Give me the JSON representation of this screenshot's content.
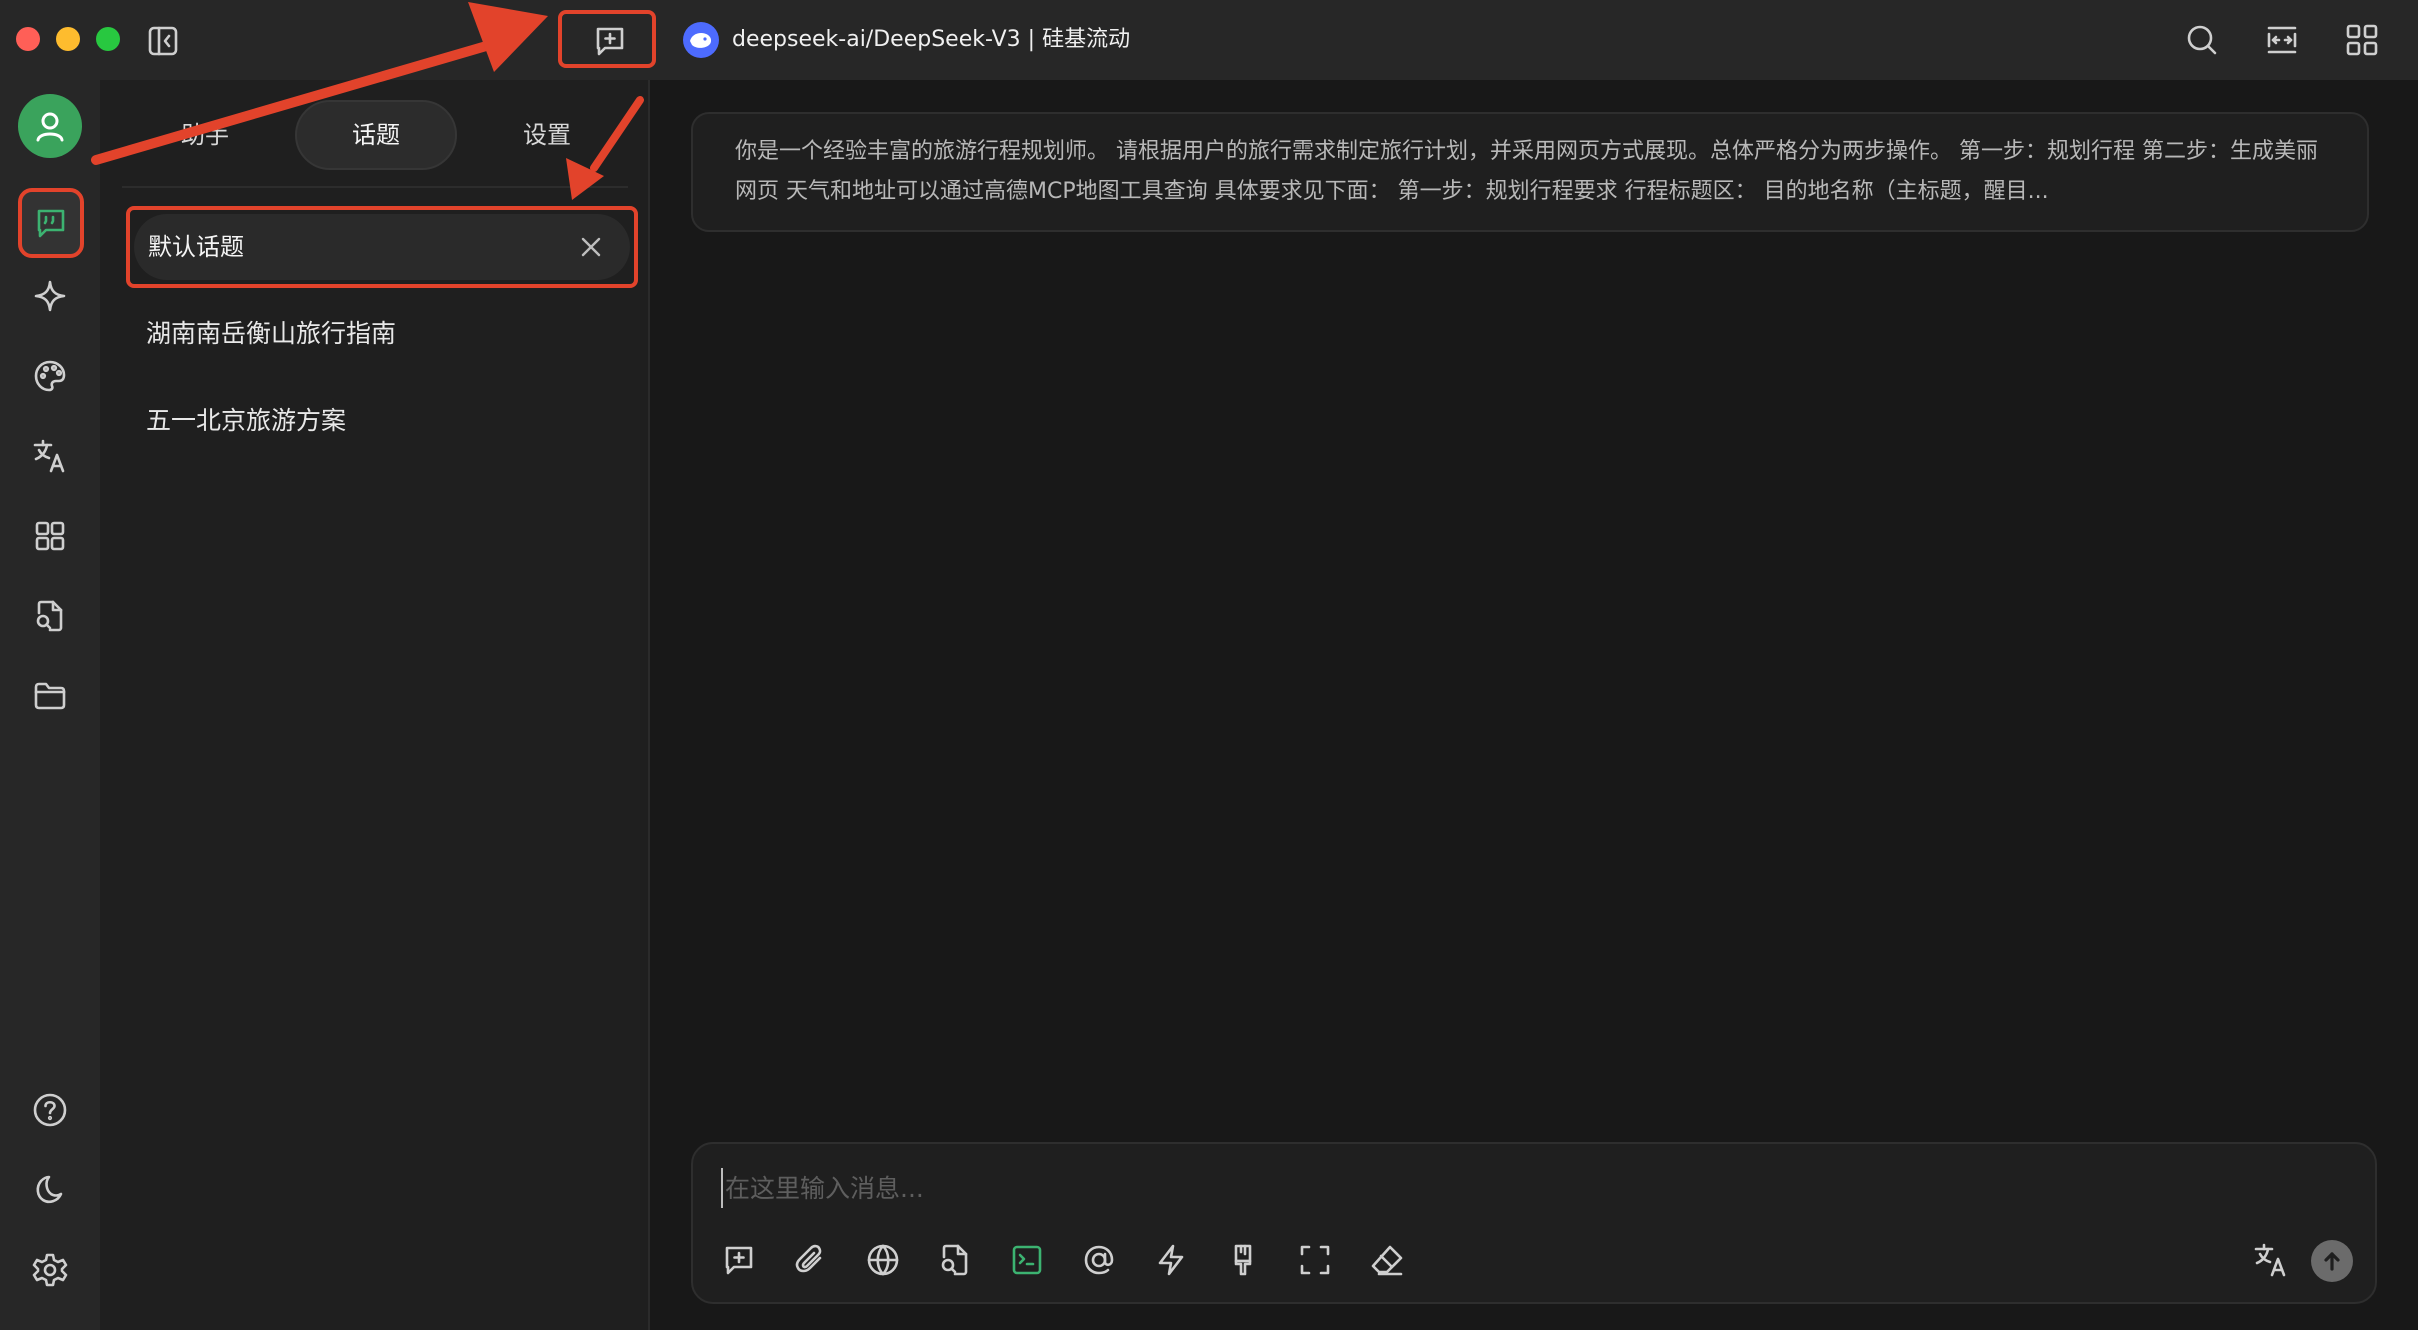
{
  "window": {
    "model_title": "deepseek-ai/DeepSeek-V3 | 硅基流动"
  },
  "titlebar": {
    "icons": [
      "sidebar-toggle-icon",
      "new-topic-icon",
      "search-icon",
      "expand-width-icon",
      "grid-icon"
    ]
  },
  "rail": {
    "items": [
      "user-avatar",
      "chat-icon",
      "sparkle-icon",
      "palette-icon",
      "translate-icon",
      "apps-icon",
      "file-search-icon",
      "folder-icon",
      "help-icon",
      "moon-icon",
      "settings-icon"
    ]
  },
  "sidebar": {
    "tabs": [
      {
        "label": "助手"
      },
      {
        "label": "话题"
      },
      {
        "label": "设置"
      }
    ],
    "active_tab": "话题",
    "topics": [
      {
        "label": "默认话题",
        "active": true
      },
      {
        "label": "湖南南岳衡山旅行指南",
        "active": false
      },
      {
        "label": "五一北京旅游方案",
        "active": false
      }
    ]
  },
  "main": {
    "system_prompt": "你是一个经验丰富的旅游行程规划师。 请根据用户的旅行需求制定旅行计划，并采用网页方式展现。总体严格分为两步操作。 第一步：规划行程 第二步：生成美丽网页 天气和地址可以通过高德MCP地图工具查询 具体要求见下面： 第一步：规划行程要求 行程标题区： 目的地名称（主标题，醒目...",
    "composer": {
      "placeholder": "在这里输入消息..."
    },
    "toolbar_icons": [
      "new-topic-icon",
      "attachment-icon",
      "web-search-icon",
      "knowledge-file-icon",
      "terminal-icon",
      "mention-icon",
      "lightning-icon",
      "brush-icon",
      "fullscreen-icon",
      "eraser-icon",
      "translate-icon",
      "send-icon"
    ]
  },
  "colors": {
    "accent_green": "#3cb371",
    "annotation_red": "#e2432b",
    "background": "#181818",
    "panel": "#1f1f1f",
    "model_avatar": "#4d6bfe"
  }
}
